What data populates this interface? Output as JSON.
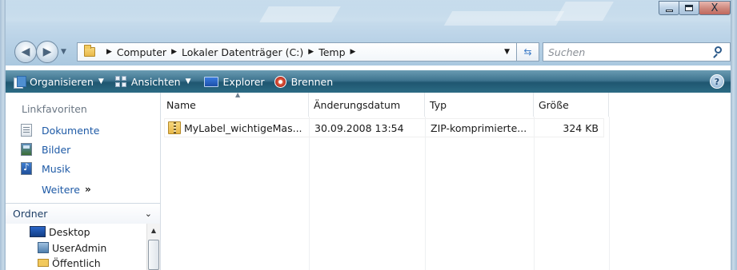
{
  "window": {
    "caption": {
      "min": "",
      "max": "",
      "close": "X"
    }
  },
  "nav": {
    "breadcrumb": [
      "Computer",
      "Lokaler Datenträger (C:)",
      "Temp"
    ],
    "search_placeholder": "Suchen"
  },
  "toolbar": {
    "organize": "Organisieren",
    "views": "Ansichten",
    "explorer": "Explorer",
    "burn": "Brennen",
    "help": "?"
  },
  "sidebar": {
    "favorites_title": "Linkfavoriten",
    "favorites": [
      {
        "label": "Dokumente",
        "icon": "documents-icon"
      },
      {
        "label": "Bilder",
        "icon": "pictures-icon"
      },
      {
        "label": "Musik",
        "icon": "music-icon"
      }
    ],
    "more": "Weitere",
    "folders_title": "Ordner",
    "tree": [
      {
        "label": "Desktop"
      },
      {
        "label": "UserAdmin"
      },
      {
        "label": "Öffentlich"
      }
    ]
  },
  "filelist": {
    "columns": [
      "Name",
      "Änderungsdatum",
      "Typ",
      "Größe"
    ],
    "rows": [
      {
        "name": "MyLabel_wichtigeMas...",
        "date": "30.09.2008 13:54",
        "type": "ZIP-komprimierte...",
        "size": "324 KB"
      }
    ]
  },
  "colors": {
    "link": "#1e5aa6",
    "toolbar_bg": "#2c6b84",
    "titlebar": "#bcd4e8"
  }
}
